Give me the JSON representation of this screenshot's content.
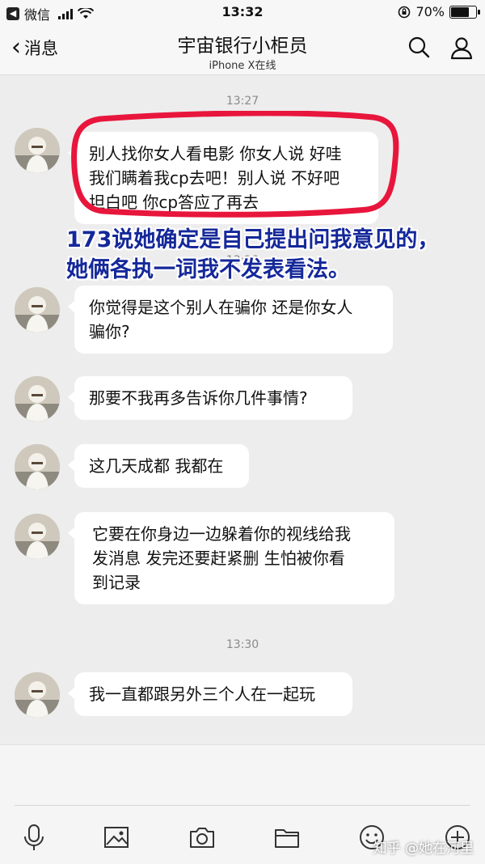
{
  "status_bar": {
    "carrier": "微信",
    "time": "13:32",
    "battery": "70%",
    "battery_level": 0.7
  },
  "header": {
    "back_label": "消息",
    "title": "宇宙银行小柜员",
    "subtitle": "iPhone X在线",
    "icons": [
      "search-icon",
      "profile-icon"
    ]
  },
  "chat": {
    "timestamps": [
      "13:27",
      "13:28",
      "13:30"
    ],
    "messages": [
      {
        "text": "别人找你女人看电影 你女人说 好哇\n我们瞒着我cp去吧！别人说 不好吧\n坦白吧 你cp答应了再去"
      },
      {
        "text": "你觉得是这个别人在骗你 还是你女人\n骗你?"
      },
      {
        "text": "那要不我再多告诉你几件事情?"
      },
      {
        "text": "这几天成都 我都在"
      },
      {
        "text": "它要在你身边一边躲着你的视线给我\n发消息 发完还要赶紧删 生怕被你看\n到记录"
      },
      {
        "text": "我一直都跟另外三个人在一起玩"
      }
    ],
    "annotation": "173说她确定是自己提出问我意见的，她俩各执一词我不发表看法。",
    "highlight_color": "#e8163c",
    "annotation_color": "#15289a"
  },
  "toolbar": {
    "icons": [
      "microphone-icon",
      "image-icon",
      "camera-icon",
      "folder-icon",
      "emoji-icon",
      "plus-icon"
    ]
  },
  "watermark": "知乎 @她在河里"
}
